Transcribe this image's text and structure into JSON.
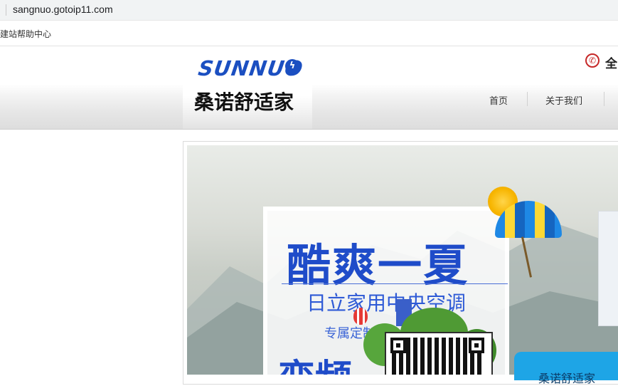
{
  "browser": {
    "url": "sangnuo.gotoip11.com",
    "bookmark_label": "建站帮助中心"
  },
  "header": {
    "logo_text": "SUNNUO",
    "site_name": "桑诺舒适家",
    "phone_glyph_visible": "全",
    "nav": {
      "home": "首页",
      "about": "关于我们"
    }
  },
  "banner": {
    "headline": "酷爽一夏",
    "subline": "日立家用中央空调",
    "tagline": "专属定制",
    "bottom_line": "变频"
  },
  "chat_widget": {
    "label": "桑诺舒适家"
  },
  "colors": {
    "brand_blue": "#1b4fc1",
    "phone_red": "#c62828",
    "chat_blue": "#1ea5e6"
  }
}
